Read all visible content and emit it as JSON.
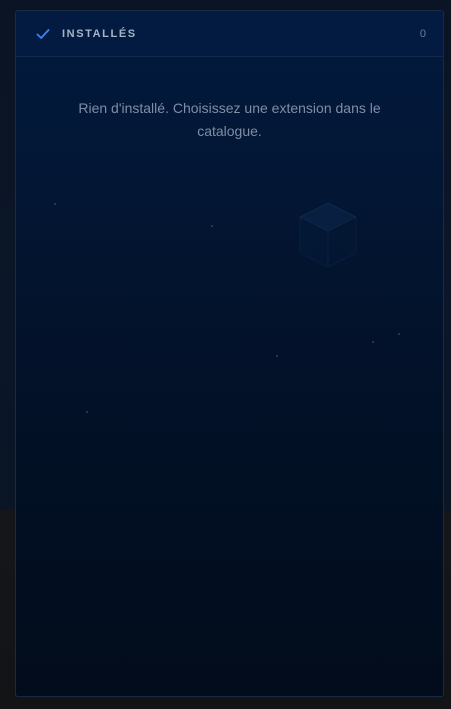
{
  "installed_panel": {
    "icon": "check-icon",
    "title": "INSTALLÉS",
    "count": "0",
    "empty_message": "Rien d'installé. Choisissez une extension dans le catalogue."
  },
  "colors": {
    "accent": "#3b82f6",
    "panel_background": "#031634",
    "text_muted": "#7f8ea6"
  }
}
